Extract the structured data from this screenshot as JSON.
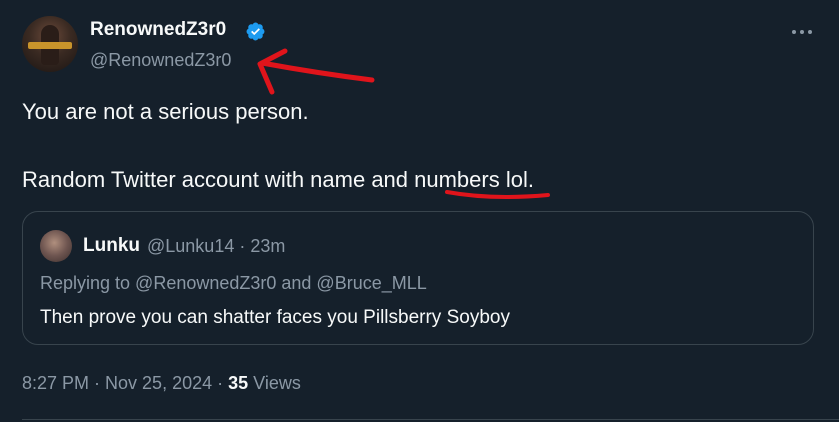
{
  "author": {
    "display_name": "RenownedZ3r0",
    "handle": "@RenownedZ3r0",
    "verified": true,
    "verified_icon": "verified-badge-icon"
  },
  "tweet": {
    "line1": "You are not a serious person.",
    "line2": "Random Twitter account with name and numbers lol."
  },
  "quoted": {
    "display_name": "Lunku",
    "handle_time": "@Lunku14 · 23m",
    "replying_to": "Replying to @RenownedZ3r0 and @Bruce_MLL",
    "text": "Then prove you can shatter faces you Pillsberry Soyboy"
  },
  "footer": {
    "timestamp": "8:27 PM · Nov 25, 2024 · ",
    "views_count": "35",
    "views_label": " Views"
  },
  "more_icon": "more-horizontal-icon",
  "colors": {
    "background": "#15202b",
    "text_primary": "#f7f9f9",
    "text_secondary": "#8b98a5",
    "border": "#38444d",
    "verified_blue": "#1d9bf0",
    "annotation_red": "#e0141b"
  }
}
